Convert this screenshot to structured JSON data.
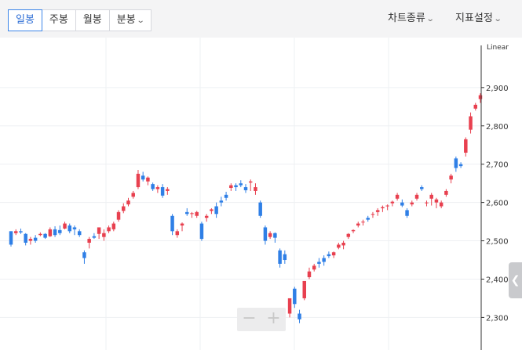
{
  "toolbar": {
    "tabs": [
      {
        "label": "일봉",
        "active": true
      },
      {
        "label": "주봉",
        "active": false
      },
      {
        "label": "월봉",
        "active": false
      },
      {
        "label": "분봉",
        "active": false,
        "has_dropdown": true
      }
    ],
    "chart_type_label": "차트종류",
    "indicator_label": "지표설정"
  },
  "scale_label": "Linear",
  "zoom": {
    "minus": "−",
    "plus": "+"
  },
  "side_toggle_icon": "chevron-left-icon",
  "colors": {
    "up": "#e8404f",
    "down": "#2f7fe6",
    "grid": "#eef0f3",
    "axis": "#333333"
  },
  "chart_data": {
    "type": "candlestick",
    "y_ticks": [
      "2,900",
      "2,800",
      "2,700",
      "2,600",
      "2,500",
      "2,400",
      "2,300"
    ],
    "y_tick_values": [
      2900,
      2800,
      2700,
      2600,
      2500,
      2400,
      2300
    ],
    "ylim": [
      2215,
      3010
    ],
    "candles": [
      [
        2525,
        2525,
        2485,
        2490
      ],
      [
        2520,
        2530,
        2515,
        2525
      ],
      [
        2525,
        2532,
        2518,
        2522
      ],
      [
        2518,
        2520,
        2488,
        2495
      ],
      [
        2500,
        2510,
        2490,
        2505
      ],
      [
        2508,
        2515,
        2495,
        2500
      ],
      [
        2515,
        2522,
        2512,
        2518
      ],
      [
        2518,
        2520,
        2505,
        2508
      ],
      [
        2512,
        2535,
        2510,
        2530
      ],
      [
        2530,
        2538,
        2510,
        2515
      ],
      [
        2528,
        2540,
        2515,
        2520
      ],
      [
        2532,
        2550,
        2530,
        2545
      ],
      [
        2540,
        2545,
        2520,
        2525
      ],
      [
        2535,
        2540,
        2515,
        2530
      ],
      [
        2525,
        2530,
        2510,
        2515
      ],
      [
        2470,
        2475,
        2440,
        2455
      ],
      [
        2495,
        2510,
        2480,
        2505
      ],
      [
        2512,
        2520,
        2505,
        2508
      ],
      [
        2518,
        2525,
        2505,
        2535
      ],
      [
        2510,
        2530,
        2500,
        2520
      ],
      [
        2525,
        2540,
        2520,
        2535
      ],
      [
        2530,
        2550,
        2525,
        2545
      ],
      [
        2555,
        2580,
        2550,
        2575
      ],
      [
        2578,
        2598,
        2572,
        2590
      ],
      [
        2595,
        2612,
        2590,
        2605
      ],
      [
        2615,
        2630,
        2610,
        2625
      ],
      [
        2640,
        2685,
        2635,
        2675
      ],
      [
        2670,
        2680,
        2655,
        2660
      ],
      [
        2655,
        2668,
        2645,
        2665
      ],
      [
        2648,
        2652,
        2630,
        2635
      ],
      [
        2635,
        2645,
        2625,
        2640
      ],
      [
        2640,
        2648,
        2612,
        2618
      ],
      [
        2630,
        2640,
        2620,
        2635
      ],
      [
        2565,
        2570,
        2515,
        2525
      ],
      [
        2515,
        2530,
        2508,
        2525
      ],
      [
        2540,
        2548,
        2525,
        2545
      ],
      [
        2575,
        2585,
        2565,
        2570
      ],
      [
        2570,
        2575,
        2560,
        2572
      ],
      [
        2565,
        2578,
        2560,
        2575
      ],
      [
        2545,
        2550,
        2500,
        2505
      ],
      [
        2560,
        2570,
        2550,
        2565
      ],
      [
        2578,
        2585,
        2570,
        2582
      ],
      [
        2590,
        2600,
        2560,
        2570
      ],
      [
        2605,
        2615,
        2590,
        2600
      ],
      [
        2620,
        2628,
        2605,
        2612
      ],
      [
        2638,
        2650,
        2630,
        2645
      ],
      [
        2645,
        2650,
        2630,
        2640
      ],
      [
        2650,
        2658,
        2640,
        2645
      ],
      [
        2640,
        2648,
        2625,
        2632
      ],
      [
        2652,
        2660,
        2630,
        2655
      ],
      [
        2630,
        2650,
        2620,
        2640
      ],
      [
        2600,
        2605,
        2560,
        2565
      ],
      [
        2535,
        2540,
        2490,
        2500
      ],
      [
        2510,
        2525,
        2505,
        2520
      ],
      [
        2520,
        2522,
        2495,
        2508
      ],
      [
        2475,
        2480,
        2430,
        2440
      ],
      [
        2465,
        2475,
        2440,
        2450
      ],
      [
        2310,
        2345,
        2300,
        2350
      ],
      [
        2375,
        2380,
        2325,
        2335
      ],
      [
        2310,
        2320,
        2285,
        2295
      ],
      [
        2350,
        2390,
        2345,
        2395
      ],
      [
        2405,
        2430,
        2400,
        2420
      ],
      [
        2425,
        2440,
        2420,
        2435
      ],
      [
        2445,
        2455,
        2430,
        2440
      ],
      [
        2455,
        2462,
        2435,
        2445
      ],
      [
        2465,
        2472,
        2455,
        2460
      ],
      [
        2462,
        2472,
        2455,
        2470
      ],
      [
        2482,
        2495,
        2478,
        2490
      ],
      [
        2488,
        2500,
        2478,
        2495
      ],
      [
        2510,
        2520,
        2505,
        2518
      ],
      [
        2525,
        2530,
        2520,
        2528
      ],
      [
        2540,
        2550,
        2535,
        2545
      ],
      [
        2548,
        2555,
        2540,
        2550
      ],
      [
        2560,
        2565,
        2550,
        2555
      ],
      [
        2568,
        2575,
        2560,
        2570
      ],
      [
        2575,
        2585,
        2565,
        2580
      ],
      [
        2585,
        2592,
        2575,
        2588
      ],
      [
        2590,
        2595,
        2580,
        2592
      ],
      [
        2598,
        2605,
        2590,
        2602
      ],
      [
        2610,
        2625,
        2605,
        2620
      ],
      [
        2600,
        2608,
        2588,
        2592
      ],
      [
        2580,
        2585,
        2560,
        2565
      ],
      [
        2595,
        2605,
        2590,
        2600
      ],
      [
        2610,
        2625,
        2605,
        2620
      ],
      [
        2640,
        2645,
        2630,
        2635
      ],
      [
        2598,
        2605,
        2590,
        2600
      ],
      [
        2610,
        2625,
        2592,
        2620
      ],
      [
        2600,
        2612,
        2585,
        2608
      ],
      [
        2590,
        2605,
        2585,
        2600
      ],
      [
        2620,
        2635,
        2615,
        2630
      ],
      [
        2660,
        2675,
        2650,
        2670
      ],
      [
        2715,
        2720,
        2680,
        2690
      ],
      [
        2700,
        2705,
        2690,
        2695
      ],
      [
        2730,
        2770,
        2720,
        2765
      ],
      [
        2790,
        2835,
        2780,
        2825
      ],
      [
        2845,
        2860,
        2840,
        2855
      ],
      [
        2870,
        2885,
        2860,
        2880
      ]
    ]
  }
}
